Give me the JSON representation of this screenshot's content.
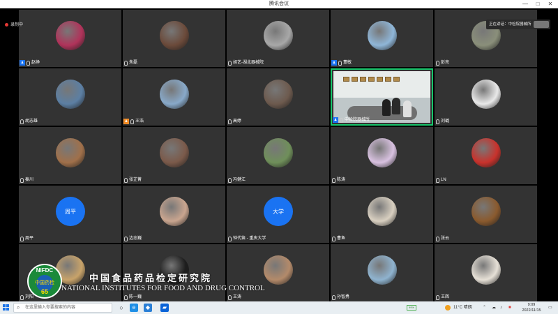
{
  "window": {
    "title": "腾讯会议"
  },
  "controls": {
    "minimize": "—",
    "maximize": "□",
    "close": "✕"
  },
  "recording": {
    "label": "录制中"
  },
  "speaking": {
    "label": "正在讲话：中检院器械所"
  },
  "participants": [
    {
      "name": "赵峥",
      "host": true,
      "host_color": "#1a73f2"
    },
    {
      "name": "朱磊"
    },
    {
      "name": "胡艺-湖北器械院"
    },
    {
      "name": "董敏",
      "host": true,
      "host_color": "#1a73f2"
    },
    {
      "name": "彭亮"
    },
    {
      "name": "胡志雄"
    },
    {
      "name": "王浩",
      "host": true,
      "host_color": "#f08a24"
    },
    {
      "name": "高婷"
    },
    {
      "name": "中检院器械所",
      "host": true,
      "host_color": "#1a73f2",
      "video": true
    },
    {
      "name": "刘璐"
    },
    {
      "name": "秦川"
    },
    {
      "name": "张芷菁"
    },
    {
      "name": "冯健江"
    },
    {
      "name": "陈涛"
    },
    {
      "name": "LN"
    },
    {
      "name": "周平",
      "avatar_text": "周平"
    },
    {
      "name": "边忠巍"
    },
    {
      "name": "钟代笛 - 重庆大学",
      "avatar_text": "大学"
    },
    {
      "name": "曹鱼"
    },
    {
      "name": "张云"
    },
    {
      "name": "刘阳"
    },
    {
      "name": "陈一巍"
    },
    {
      "name": "王涛"
    },
    {
      "name": "孙智勇"
    },
    {
      "name": "王辉"
    }
  ],
  "watermark": {
    "seal_text": "NIFDC",
    "seal_sub": "中国药检",
    "chinese": "中国食品药品检定研究院",
    "english": "NATIONAL INSTITUTES FOR FOOD AND DRUG CONTROL"
  },
  "taskbar": {
    "search_placeholder": "在这里输入你要搜索的内容",
    "battery": "99%",
    "weather": "11°C 晴朗",
    "time": "9:09",
    "date": "2022/11/15"
  }
}
